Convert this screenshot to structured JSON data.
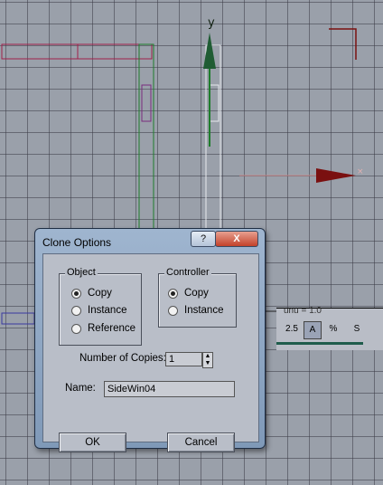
{
  "viewport": {
    "axis_label": "y"
  },
  "toolbar_fragment": {
    "label": "unu = 1.0",
    "buttons": [
      "2.5",
      "A",
      "%",
      "S"
    ]
  },
  "dialog": {
    "title": "Clone Options",
    "help_label": "?",
    "close_label": "X",
    "object_group": {
      "title": "Object",
      "options": [
        "Copy",
        "Instance",
        "Reference"
      ],
      "selected": "Copy"
    },
    "controller_group": {
      "title": "Controller",
      "options": [
        "Copy",
        "Instance"
      ],
      "selected": "Copy"
    },
    "copies_label": "Number of Copies:",
    "copies_value": "1",
    "name_label": "Name:",
    "name_value": "SideWin04",
    "ok_label": "OK",
    "cancel_label": "Cancel"
  }
}
